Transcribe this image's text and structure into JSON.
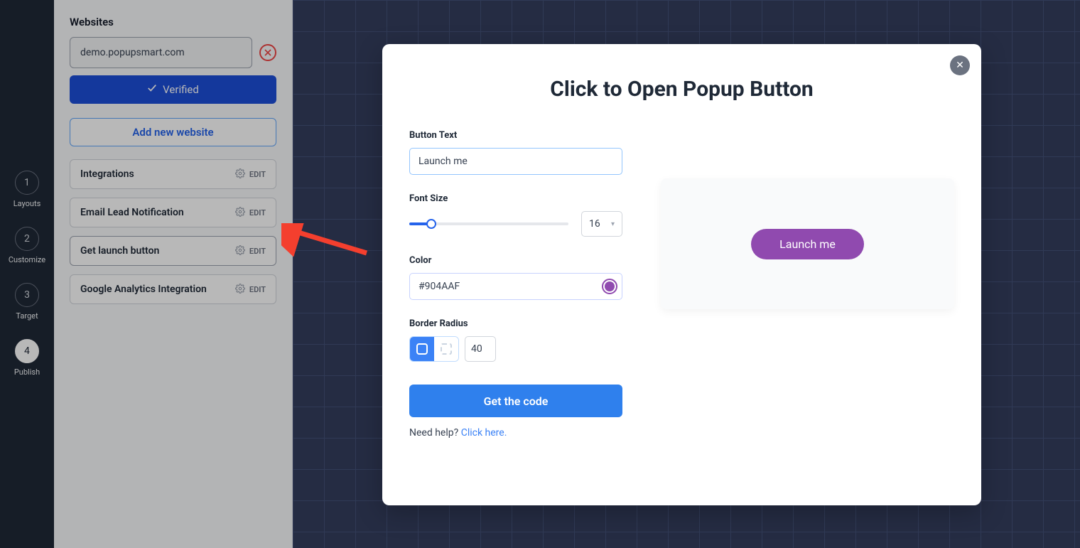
{
  "rail": {
    "steps": [
      {
        "num": "1",
        "label": "Layouts"
      },
      {
        "num": "2",
        "label": "Customize"
      },
      {
        "num": "3",
        "label": "Target"
      },
      {
        "num": "4",
        "label": "Publish"
      }
    ],
    "activeIndex": 3
  },
  "sidebar": {
    "websites_heading": "Websites",
    "website_value": "demo.popupsmart.com",
    "verified_label": "Verified",
    "add_website_label": "Add new website",
    "edit_label": "EDIT",
    "items": [
      {
        "title": "Integrations"
      },
      {
        "title": "Email Lead Notification"
      },
      {
        "title": "Get launch button"
      },
      {
        "title": "Google Analytics Integration"
      }
    ]
  },
  "modal": {
    "title": "Click to Open Popup Button",
    "button_text_label": "Button Text",
    "button_text_value": "Launch me",
    "font_size_label": "Font Size",
    "font_size_value": "16",
    "color_label": "Color",
    "color_value": "#904AAF",
    "border_radius_label": "Border Radius",
    "border_radius_value": "40",
    "get_code_label": "Get the code",
    "help_text": "Need help? ",
    "help_link": "Click here.",
    "preview_button_label": "Launch me"
  }
}
